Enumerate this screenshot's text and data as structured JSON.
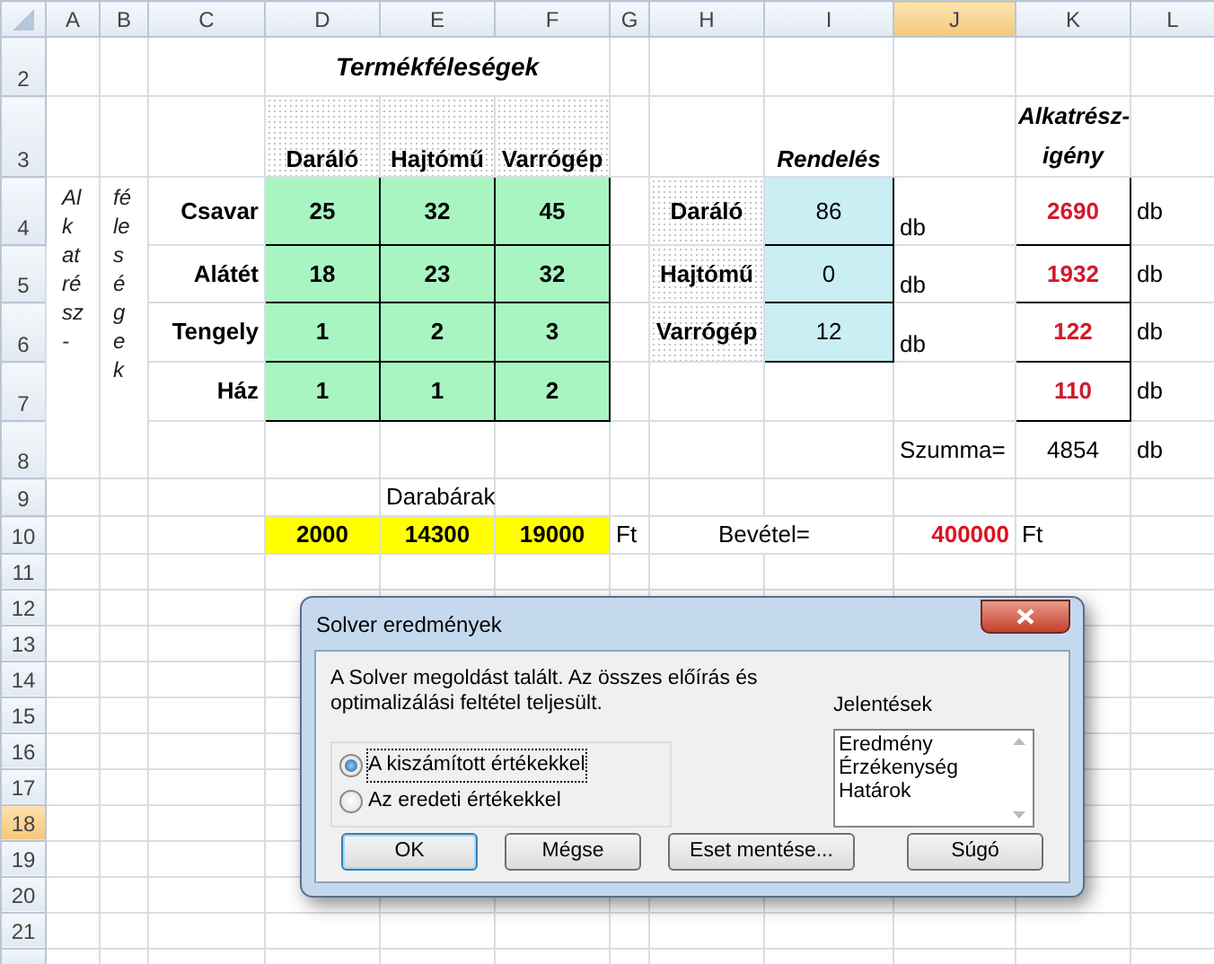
{
  "column_headers": [
    {
      "label": "A",
      "selected": false
    },
    {
      "label": "B",
      "selected": false
    },
    {
      "label": "C",
      "selected": false
    },
    {
      "label": "D",
      "selected": false
    },
    {
      "label": "E",
      "selected": false
    },
    {
      "label": "F",
      "selected": false
    },
    {
      "label": "G",
      "selected": false
    },
    {
      "label": "H",
      "selected": false
    },
    {
      "label": "I",
      "selected": false
    },
    {
      "label": "J",
      "selected": true
    },
    {
      "label": "K",
      "selected": false
    },
    {
      "label": "L",
      "selected": false
    }
  ],
  "row_headers": [
    {
      "label": "2",
      "selected": false
    },
    {
      "label": "3",
      "selected": false
    },
    {
      "label": "4",
      "selected": false
    },
    {
      "label": "5",
      "selected": false
    },
    {
      "label": "6",
      "selected": false
    },
    {
      "label": "7",
      "selected": false
    },
    {
      "label": "8",
      "selected": false
    },
    {
      "label": "9",
      "selected": false
    },
    {
      "label": "10",
      "selected": false
    },
    {
      "label": "11",
      "selected": false
    },
    {
      "label": "12",
      "selected": false
    },
    {
      "label": "13",
      "selected": false
    },
    {
      "label": "14",
      "selected": false
    },
    {
      "label": "15",
      "selected": false
    },
    {
      "label": "16",
      "selected": false
    },
    {
      "label": "17",
      "selected": false
    },
    {
      "label": "18",
      "selected": true
    },
    {
      "label": "19",
      "selected": false
    },
    {
      "label": "20",
      "selected": false
    },
    {
      "label": "21",
      "selected": false
    }
  ],
  "sheet": {
    "title": "Termékféleségek",
    "product_headers": [
      "Daráló",
      "Hajtómű",
      "Varrógép"
    ],
    "side_label_1": "Alkatrész-",
    "side_label_2": "féleségek",
    "parts": [
      {
        "name": "Csavar",
        "values": [
          "25",
          "32",
          "45"
        ]
      },
      {
        "name": "Alátét",
        "values": [
          "18",
          "23",
          "32"
        ]
      },
      {
        "name": "Tengely",
        "values": [
          "1",
          "2",
          "3"
        ]
      },
      {
        "name": "Ház",
        "values": [
          "1",
          "1",
          "2"
        ]
      }
    ],
    "order_title": "Rendelés",
    "orders": [
      {
        "product": "Daráló",
        "quantity": "86",
        "unit": "db"
      },
      {
        "product": "Hajtómű",
        "quantity": "0",
        "unit": "db"
      },
      {
        "product": "Varrógép",
        "quantity": "12",
        "unit": "db"
      }
    ],
    "demand_title": "Alkatrész-igény",
    "demands": [
      {
        "value": "2690",
        "unit": "db"
      },
      {
        "value": "1932",
        "unit": "db"
      },
      {
        "value": "122",
        "unit": "db"
      },
      {
        "value": "110",
        "unit": "db"
      }
    ],
    "sum_label": "Szumma=",
    "sum_value": "4854",
    "sum_unit": "db",
    "price_title": "Darabárak",
    "prices": [
      "2000",
      "14300",
      "19000"
    ],
    "price_unit": "Ft",
    "revenue_label": "Bevétel=",
    "revenue_value": "400000",
    "revenue_unit": "Ft"
  },
  "dialog": {
    "title": "Solver eredmények",
    "message": "A Solver megoldást talált. Az összes előírás és optimalizálási feltétel teljesült.",
    "options": [
      {
        "label": "A kiszámított értékekkel",
        "selected": true
      },
      {
        "label": "Az eredeti értékekkel",
        "selected": false
      }
    ],
    "reports_label": "Jelentések",
    "reports": [
      "Eredmény",
      "Érzékenység",
      "Határok"
    ],
    "buttons": [
      {
        "label": "OK",
        "default": true
      },
      {
        "label": "Mégse",
        "default": false
      },
      {
        "label": "Eset mentése...",
        "default": false
      },
      {
        "label": "Súgó",
        "default": false
      }
    ]
  }
}
